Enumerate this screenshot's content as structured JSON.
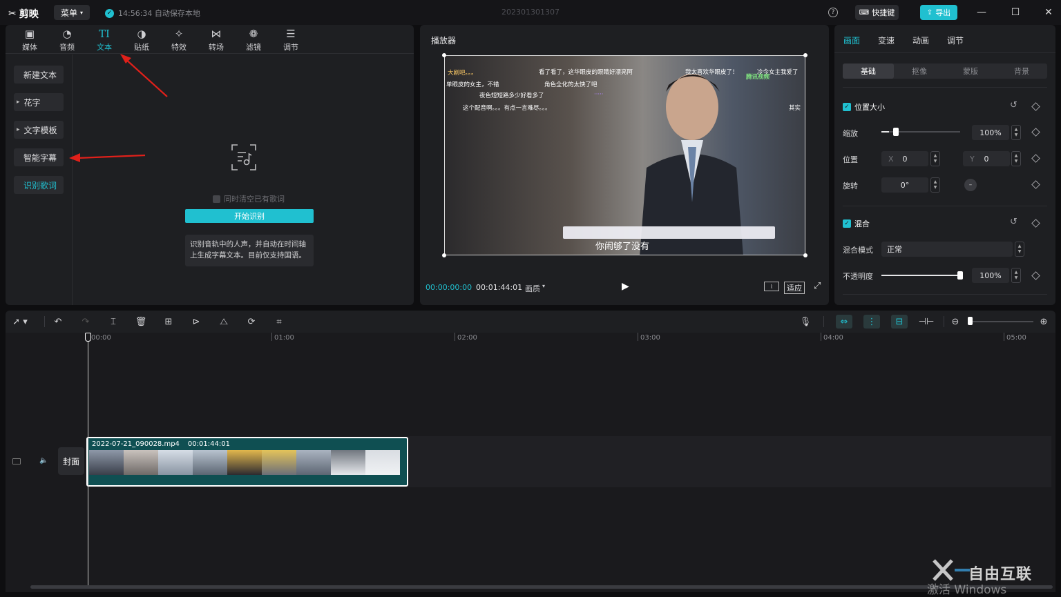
{
  "app": {
    "logo": "剪映",
    "menu_label": "菜单",
    "autosave_text": "14:56:34 自动保存本地",
    "project_title": "202301301307",
    "help": "?",
    "shortcut_label": "快捷键",
    "export_label": "导出",
    "accent_color": "#20c0d0"
  },
  "left_panel": {
    "tabs": [
      {
        "label": "媒体",
        "icon": "media-icon"
      },
      {
        "label": "音频",
        "icon": "audio-icon"
      },
      {
        "label": "文本",
        "icon": "text-icon"
      },
      {
        "label": "贴纸",
        "icon": "sticker-icon"
      },
      {
        "label": "特效",
        "icon": "effects-icon"
      },
      {
        "label": "转场",
        "icon": "transition-icon"
      },
      {
        "label": "滤镜",
        "icon": "filter-icon"
      },
      {
        "label": "调节",
        "icon": "adjust-icon"
      }
    ],
    "active_tab": "文本",
    "side_items": [
      {
        "label": "新建文本"
      },
      {
        "label": "花字"
      },
      {
        "label": "文字模板"
      },
      {
        "label": "智能字幕"
      },
      {
        "label": "识别歌词"
      }
    ],
    "selected_item": "识别歌词",
    "clear_lyrics_label": "同时清空已有歌词",
    "start_button": "开始识别",
    "description": "识别音轨中的人声，并自动在时间轴上生成字幕文本。目前仅支持国语。"
  },
  "player": {
    "title": "播放器",
    "current_time": "00:00:00:00",
    "total_time": "00:01:44:01",
    "quality_label": "画质",
    "fit_label": "适应",
    "video_overlay_texts": [
      "大剧吧。。。",
      "看了看了，这华眼皮的眼睛好漂亮阿",
      "我太喜欢华眼皮了！",
      "冷今女主我爱了",
      "单眼皮的女主，不错",
      "角色全化的太快了吧",
      "夜色短短路多少好看多了",
      "腾讯视频",
      "这个配音啊。。。有点一言难尽。。。",
      "其实",
      "你闹够了没有"
    ],
    "subtitle": "你闹够了没有"
  },
  "right_panel": {
    "tabs": [
      "画面",
      "变速",
      "动画",
      "调节"
    ],
    "active_tab": "画面",
    "segments": [
      "基础",
      "抠像",
      "蒙版",
      "背景"
    ],
    "active_segment": "基础",
    "position_size": {
      "title": "位置大小",
      "scale_label": "缩放",
      "scale_value": "100%",
      "scale_level": 0.1,
      "position_label": "位置",
      "x_label": "X",
      "x_value": "0",
      "y_label": "Y",
      "y_value": "0",
      "rotate_label": "旋转",
      "rotate_value": "0°"
    },
    "blend": {
      "title": "混合",
      "mode_label": "混合模式",
      "mode_value": "正常",
      "opacity_label": "不透明度",
      "opacity_value": "100%",
      "opacity_level": 1.0
    }
  },
  "timeline": {
    "ruler": [
      "00:00",
      "01:00",
      "02:00",
      "03:00",
      "04:00",
      "05:00"
    ],
    "cover_label": "封面",
    "clip": {
      "name": "2022-07-21_090028.mp4",
      "duration": "00:01:44:01"
    }
  },
  "watermark": {
    "brand": "自由互联",
    "activate": "激活 Windows"
  }
}
